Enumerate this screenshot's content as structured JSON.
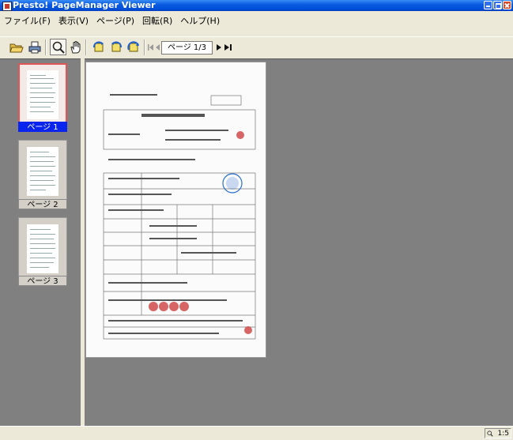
{
  "window": {
    "title": "Presto! PageManager Viewer"
  },
  "menu": [
    "ファイル(F)",
    "表示(V)",
    "ページ(P)",
    "回転(R)",
    "ヘルプ(H)"
  ],
  "toolbar": {
    "page_indicator": "ページ 1/3"
  },
  "thumbnails": [
    {
      "label": "ページ 1",
      "selected": true
    },
    {
      "label": "ページ 2",
      "selected": false
    },
    {
      "label": "ページ 3",
      "selected": false
    }
  ],
  "status": {
    "zoom": "1:5"
  },
  "colors": {
    "selection": "#0a24f0",
    "selected_border": "#e05555",
    "background": "#808080"
  }
}
